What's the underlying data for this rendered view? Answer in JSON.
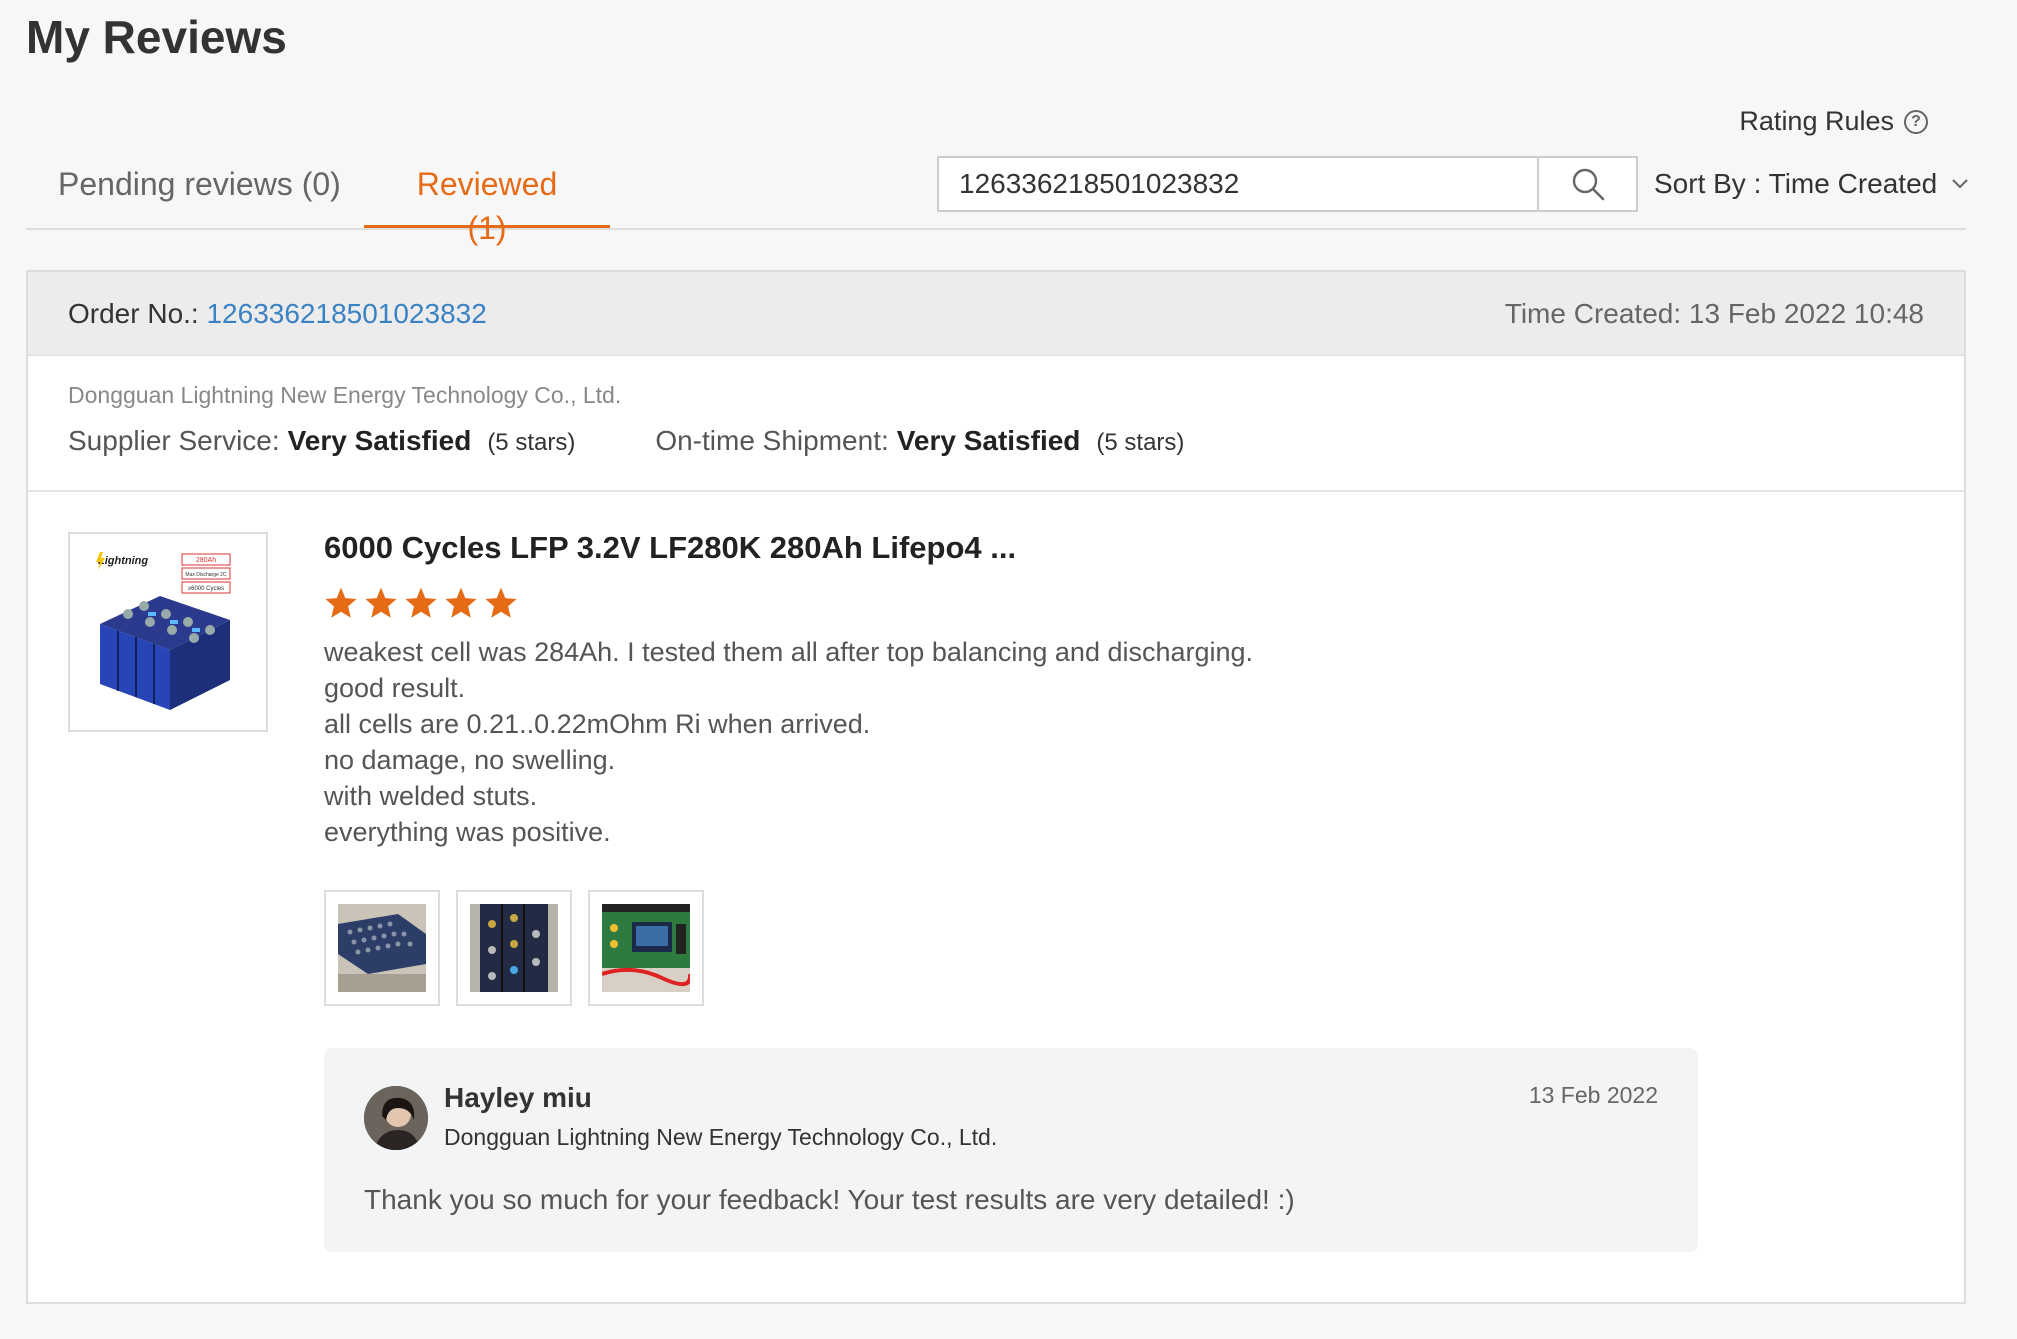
{
  "page": {
    "title": "My Reviews"
  },
  "rating_rules": {
    "label": "Rating Rules",
    "icon": "help-circle-icon"
  },
  "tabs": [
    {
      "label": "Pending reviews (0)",
      "active": false
    },
    {
      "label": "Reviewed (1)",
      "active": true
    }
  ],
  "search": {
    "value": "126336218501023832",
    "icon": "search-icon"
  },
  "sort": {
    "label": "Sort By : Time Created",
    "icon": "chevron-down-icon"
  },
  "order": {
    "label": "Order No.:",
    "number": "126336218501023832",
    "time_created": "Time Created: 13 Feb 2022 10:48",
    "supplier": "Dongguan Lightning New Energy Technology Co., Ltd.",
    "ratings": [
      {
        "label": "Supplier Service:",
        "value": "Very Satisfied",
        "stars": "(5 stars)"
      },
      {
        "label": "On-time Shipment:",
        "value": "Very Satisfied",
        "stars": "(5 stars)"
      }
    ]
  },
  "product": {
    "title": "6000 Cycles LFP 3.2V LF280K 280Ah Lifepo4 ...",
    "rating": 5,
    "review_lines": [
      "weakest cell was 284Ah. I tested them all after top balancing and discharging.",
      "good result.",
      "all cells are 0.21..0.22mOhm Ri when arrived.",
      "no damage, no swelling.",
      "with welded stuts.",
      "everything was positive."
    ],
    "thumb_text": {
      "brand": "Lightning",
      "capacity": "280Ah",
      "discharge": "Max Discharge 2C",
      "cycles": "≥6000 Cycles"
    }
  },
  "reply": {
    "name": "Hayley miu",
    "company": "Dongguan Lightning New Energy Technology Co., Ltd.",
    "date": "13 Feb 2022",
    "text": "Thank you so much for your feedback! Your test results are very detailed!   :)"
  },
  "colors": {
    "accent": "#e66b17",
    "link": "#3b82c4",
    "star": "#e66b17"
  }
}
